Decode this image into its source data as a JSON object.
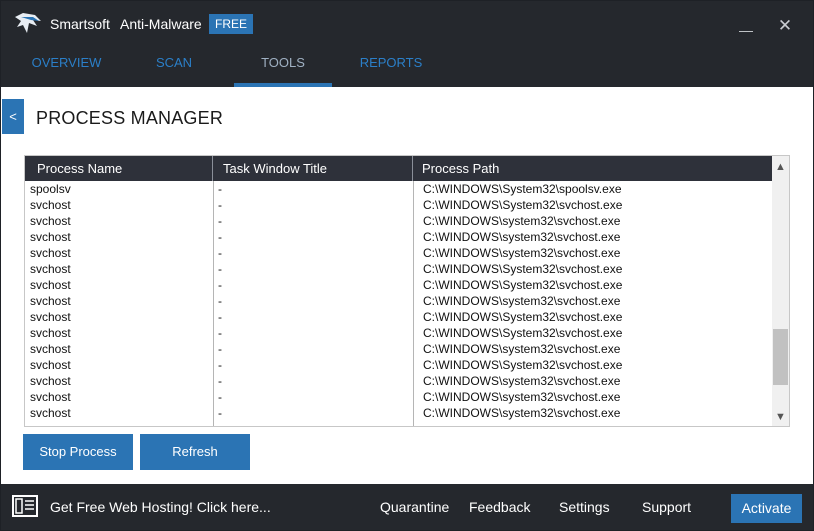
{
  "app": {
    "brand": "Smartsoft",
    "product": "Anti-Malware",
    "badge": "FREE",
    "minimize_glyph": "—",
    "close_glyph": "✕"
  },
  "nav": {
    "tabs": [
      {
        "label": "OVERVIEW",
        "active": false
      },
      {
        "label": "SCAN",
        "active": false
      },
      {
        "label": "TOOLS",
        "active": true
      },
      {
        "label": "REPORTS",
        "active": false
      }
    ]
  },
  "page": {
    "back_label": "<",
    "title": "PROCESS MANAGER"
  },
  "table": {
    "columns": [
      "Process Name",
      "Task Window Title",
      "Process Path"
    ],
    "rows": [
      [
        "spoolsv",
        "-",
        "C:\\WINDOWS\\System32\\spoolsv.exe"
      ],
      [
        "svchost",
        "-",
        "C:\\WINDOWS\\System32\\svchost.exe"
      ],
      [
        "svchost",
        "-",
        "C:\\WINDOWS\\system32\\svchost.exe"
      ],
      [
        "svchost",
        "-",
        "C:\\WINDOWS\\system32\\svchost.exe"
      ],
      [
        "svchost",
        "-",
        "C:\\WINDOWS\\system32\\svchost.exe"
      ],
      [
        "svchost",
        "-",
        "C:\\WINDOWS\\System32\\svchost.exe"
      ],
      [
        "svchost",
        "-",
        "C:\\WINDOWS\\System32\\svchost.exe"
      ],
      [
        "svchost",
        "-",
        "C:\\WINDOWS\\system32\\svchost.exe"
      ],
      [
        "svchost",
        "-",
        "C:\\WINDOWS\\System32\\svchost.exe"
      ],
      [
        "svchost",
        "-",
        "C:\\WINDOWS\\System32\\svchost.exe"
      ],
      [
        "svchost",
        "-",
        "C:\\WINDOWS\\system32\\svchost.exe"
      ],
      [
        "svchost",
        "-",
        "C:\\WINDOWS\\System32\\svchost.exe"
      ],
      [
        "svchost",
        "-",
        "C:\\WINDOWS\\system32\\svchost.exe"
      ],
      [
        "svchost",
        "-",
        "C:\\WINDOWS\\system32\\svchost.exe"
      ],
      [
        "svchost",
        "-",
        "C:\\WINDOWS\\system32\\svchost.exe"
      ]
    ],
    "scroll_up_glyph": "▲",
    "scroll_down_glyph": "▼"
  },
  "actions": {
    "stop_label": "Stop Process",
    "refresh_label": "Refresh"
  },
  "footer": {
    "hosting_label": "Get Free Web Hosting! Click here...",
    "links": [
      "Quarantine",
      "Feedback",
      "Settings",
      "Support"
    ],
    "activate_label": "Activate"
  },
  "colors": {
    "accent": "#2b74b4",
    "chrome": "#25282d",
    "table_header": "#2e313a"
  }
}
